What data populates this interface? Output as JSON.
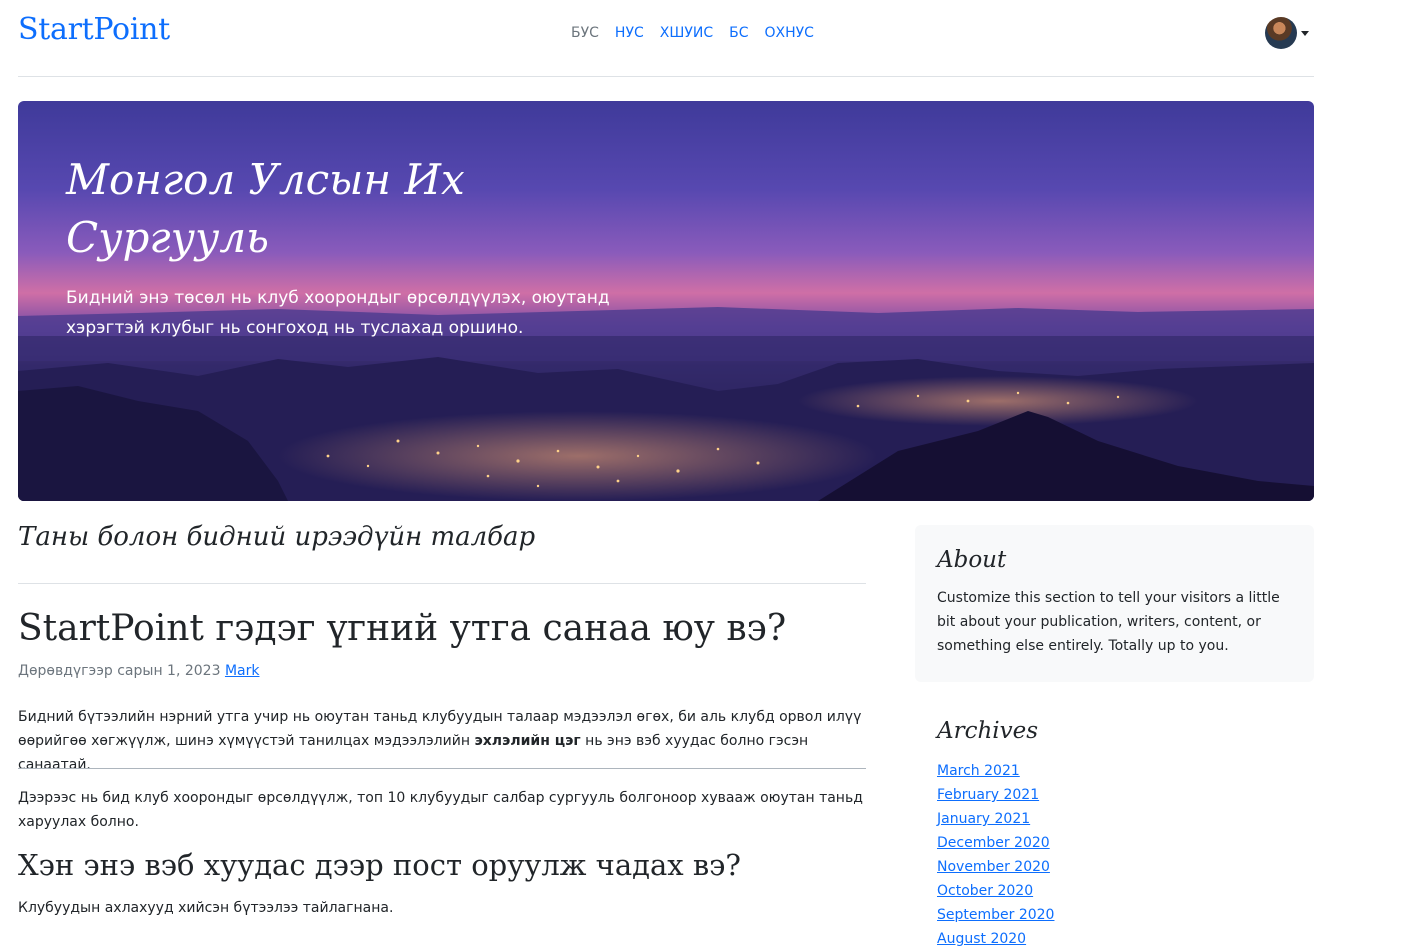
{
  "header": {
    "brand": "StartPoint",
    "nav": [
      {
        "label": "БУС",
        "active": false
      },
      {
        "label": "НУС",
        "active": true
      },
      {
        "label": "ХШУИС",
        "active": true
      },
      {
        "label": "БС",
        "active": true
      },
      {
        "label": "ОХНУС",
        "active": true
      }
    ]
  },
  "hero": {
    "title": "Монгол Улсын Их Сургууль",
    "lead": "Бидний энэ төсөл нь клуб хоорондыг өрсөлдүүлэх, оюутанд хэрэгтэй клубыг нь сонгоход нь туслахад оршино."
  },
  "main": {
    "tagline": "Таны болон бидний ирээдүйн талбар",
    "post": {
      "title": "StartPoint гэдэг үгний утга санаа юу вэ?",
      "date": "Дөрөвдүгээр сарын 1, 2023",
      "author": "Mark",
      "p1_start": "Бидний бүтээлийн нэрний утга учир нь оюутан таньд клубуудын талаар мэдээлэл өгөх, би аль клубд орвол илүү өөрийгөө хөгжүүлж, шинэ хүмүүстэй танилцах мэдээлэлийн ",
      "p1_bold": "эхлэлийн цэг",
      "p1_end": " нь энэ вэб хуудас болно гэсэн санаатай.",
      "p2": "Дээрээс нь бид клуб хоорондыг өрсөлдүүлж, топ 10 клубуудыг салбар сургууль болгоноор хувааж оюутан таньд харуулах болно.",
      "h2": "Хэн энэ вэб хуудас дээр пост оруулж чадах вэ?",
      "p3": "Клубуудын ахлахууд хийсэн бүтээлээ тайлагнана."
    }
  },
  "sidebar": {
    "about_title": "About",
    "about_text": "Customize this section to tell your visitors a little bit about your publication, writers, content, or something else entirely. Totally up to you.",
    "archives_title": "Archives",
    "archives": [
      "March 2021",
      "February 2021",
      "January 2021",
      "December 2020",
      "November 2020",
      "October 2020",
      "September 2020",
      "August 2020"
    ]
  },
  "colors": {
    "link": "#0d6efd",
    "muted": "#6c757d",
    "text": "#212529",
    "sidebar_bg": "#f8f9fa"
  }
}
